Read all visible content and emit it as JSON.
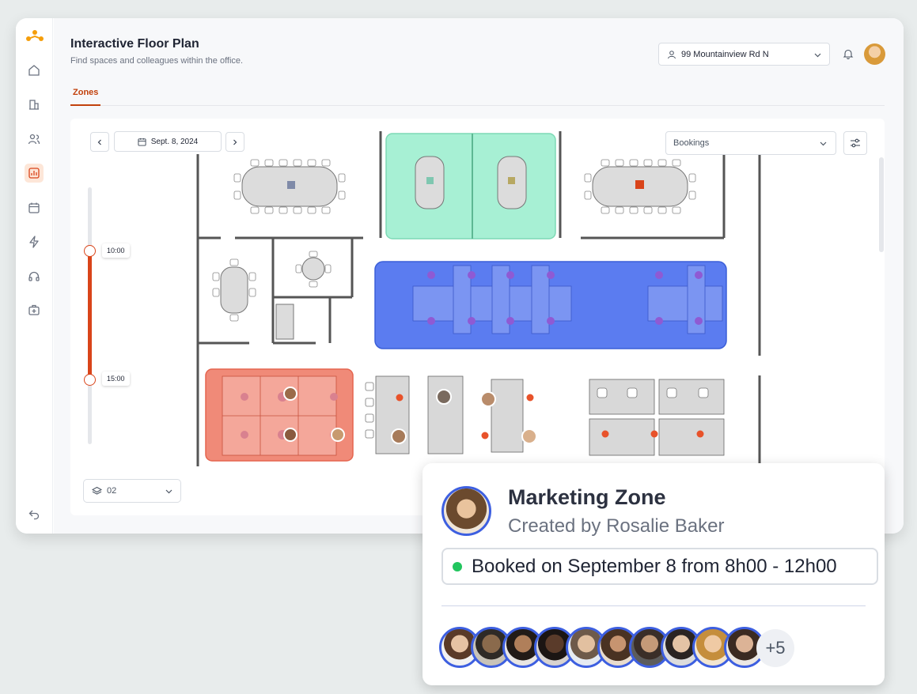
{
  "header": {
    "title": "Interactive Floor Plan",
    "subtitle": "Find spaces and colleagues within the office.",
    "location": "99 Mountainview Rd N"
  },
  "tabs": [
    {
      "label": "Zones",
      "active": true
    }
  ],
  "toolbar": {
    "date": "Sept. 8, 2024",
    "view_select": "Bookings"
  },
  "time_slider": {
    "start_label": "10:00",
    "end_label": "15:00"
  },
  "floor_select": "02",
  "popup": {
    "title": "Marketing Zone",
    "created_by": "Created by Rosalie Baker",
    "booking": "Booked on September 8 from 8h00 - 12h00",
    "more_count": "+5"
  },
  "colors": {
    "accent": "#d9441a",
    "zone_green": "#a7f0d4",
    "zone_blue": "#5b7cf0",
    "zone_red": "#f08a78",
    "avatar_ring": "#3d5fe0"
  },
  "sidebar": {
    "items": [
      "home-icon",
      "building-icon",
      "users-icon",
      "chart-icon",
      "calendar-icon",
      "bolt-icon",
      "headset-icon",
      "medkit-icon"
    ],
    "active": "chart-icon",
    "bottom": "logout-icon"
  }
}
